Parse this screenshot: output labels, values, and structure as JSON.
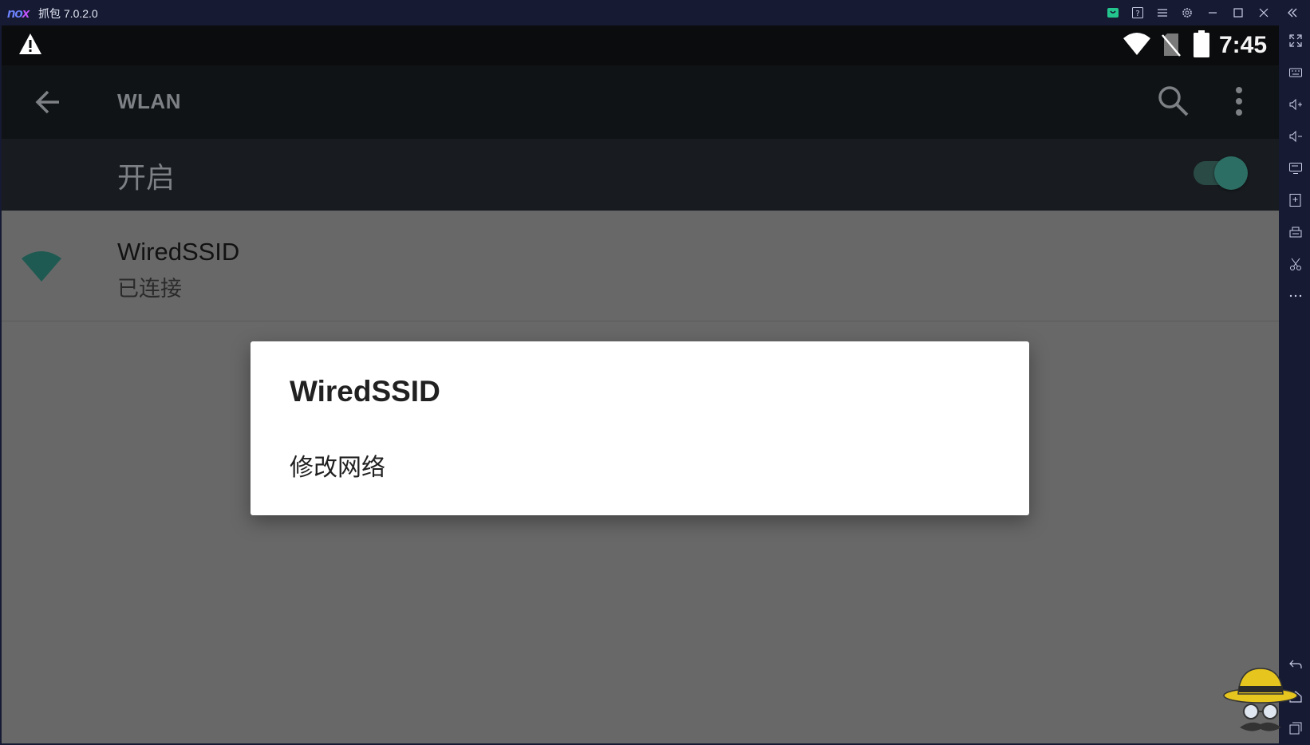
{
  "window": {
    "logo_main": "no",
    "logo_x": "x",
    "title": "抓包 7.0.2.0",
    "controls": [
      "shop-icon",
      "help-icon",
      "menu-icon",
      "settings-icon",
      "minimize-icon",
      "maximize-icon",
      "close-icon",
      "collapse-icon"
    ]
  },
  "sidebar": {
    "tools": [
      "fullscreen-icon",
      "keyboard-icon",
      "volume-up-icon",
      "volume-down-icon",
      "screen-icon",
      "add-apk-icon",
      "printer-icon",
      "scissors-icon",
      "more-icon",
      "back-icon",
      "home-icon",
      "recents-icon"
    ]
  },
  "android": {
    "status_bar": {
      "time": "7:45"
    },
    "app_bar": {
      "title": "WLAN"
    },
    "wifi_switch": {
      "label": "开启",
      "on": true
    },
    "network": {
      "ssid": "WiredSSID",
      "status": "已连接"
    },
    "dialog": {
      "title": "WiredSSID",
      "item": "修改网络"
    }
  },
  "colors": {
    "emulator_frame": "#161a33",
    "accent_teal": "#2d6e64",
    "dim_overlay": "#686868"
  }
}
